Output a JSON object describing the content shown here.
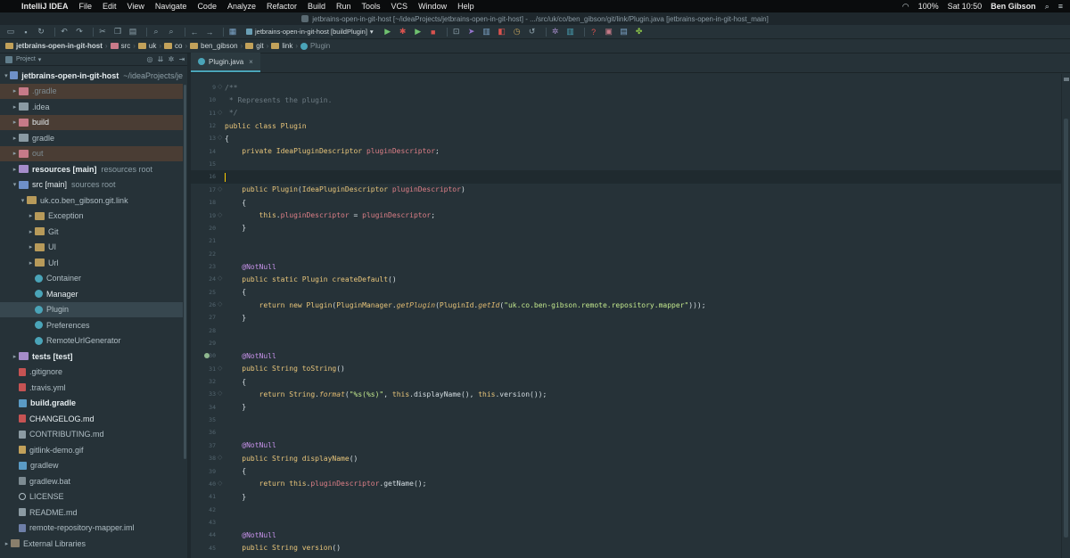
{
  "menubar": {
    "app_name": "IntelliJ IDEA",
    "items": [
      "File",
      "Edit",
      "View",
      "Navigate",
      "Code",
      "Analyze",
      "Refactor",
      "Build",
      "Run",
      "Tools",
      "VCS",
      "Window",
      "Help"
    ],
    "battery": "100%",
    "clock": "Sat 10:50",
    "user": "Ben Gibson"
  },
  "window": {
    "title": "jetbrains-open-in-git-host [~/ideaProjects/jetbrains-open-in-git-host] - .../src/uk/co/ben_gibson/git/link/Plugin.java [jetbrains-open-in-git-host_main]"
  },
  "toolbar": {
    "run_config": "jetbrains-open-in-git-host [buildPlugin]"
  },
  "breadcrumbs": [
    "jetbrains-open-in-git-host",
    "src",
    "uk",
    "co",
    "ben_gibson",
    "git",
    "link",
    "Plugin"
  ],
  "project_panel": {
    "title": "Project"
  },
  "tree": [
    {
      "label": "jetbrains-open-in-git-host",
      "hint": "~/ideaProjects/je",
      "depth": 0,
      "arrow": "v",
      "icon": "folder-blue",
      "style": "bold"
    },
    {
      "label": ".gradle",
      "hint": "",
      "depth": 1,
      "arrow": ">",
      "icon": "folder-pink",
      "style": "dim",
      "hl": "brown"
    },
    {
      "label": ".idea",
      "hint": "",
      "depth": 1,
      "arrow": ">",
      "icon": "folder",
      "style": ""
    },
    {
      "label": "build",
      "hint": "",
      "depth": 1,
      "arrow": ">",
      "icon": "folder-pink",
      "style": "white",
      "hl": "brown"
    },
    {
      "label": "gradle",
      "hint": "",
      "depth": 1,
      "arrow": ">",
      "icon": "folder",
      "style": ""
    },
    {
      "label": "out",
      "hint": "",
      "depth": 1,
      "arrow": ">",
      "icon": "folder-pink",
      "style": "dim",
      "hl": "brown"
    },
    {
      "label": "resources [main]",
      "hint": "resources root",
      "depth": 1,
      "arrow": ">",
      "icon": "folder-purple",
      "style": "bold"
    },
    {
      "label": "src [main]",
      "hint": "sources root",
      "depth": 1,
      "arrow": "v",
      "icon": "folder-blue",
      "style": "white"
    },
    {
      "label": "uk.co.ben_gibson.git.link",
      "hint": "",
      "depth": 2,
      "arrow": "v",
      "icon": "pkg",
      "style": ""
    },
    {
      "label": "Exception",
      "hint": "",
      "depth": 3,
      "arrow": ">",
      "icon": "pkg",
      "style": ""
    },
    {
      "label": "Git",
      "hint": "",
      "depth": 3,
      "arrow": ">",
      "icon": "pkg",
      "style": ""
    },
    {
      "label": "UI",
      "hint": "",
      "depth": 3,
      "arrow": ">",
      "icon": "pkg",
      "style": ""
    },
    {
      "label": "Url",
      "hint": "",
      "depth": 3,
      "arrow": ">",
      "icon": "pkg",
      "style": ""
    },
    {
      "label": "Container",
      "hint": "",
      "depth": 3,
      "arrow": "",
      "icon": "cls",
      "style": ""
    },
    {
      "label": "Manager",
      "hint": "",
      "depth": 3,
      "arrow": "",
      "icon": "cls",
      "style": "white"
    },
    {
      "label": "Plugin",
      "hint": "",
      "depth": 3,
      "arrow": "",
      "icon": "cls",
      "style": "",
      "selected": true
    },
    {
      "label": "Preferences",
      "hint": "",
      "depth": 3,
      "arrow": "",
      "icon": "cls",
      "style": ""
    },
    {
      "label": "RemoteUrlGenerator",
      "hint": "",
      "depth": 3,
      "arrow": "",
      "icon": "cls",
      "style": ""
    },
    {
      "label": "tests [test]",
      "hint": "",
      "depth": 1,
      "arrow": ">",
      "icon": "folder-purple",
      "style": "bold"
    },
    {
      "label": ".gitignore",
      "hint": "",
      "depth": 1,
      "arrow": "",
      "icon": "file-red",
      "style": ""
    },
    {
      "label": ".travis.yml",
      "hint": "",
      "depth": 1,
      "arrow": "",
      "icon": "file-red",
      "style": ""
    },
    {
      "label": "build.gradle",
      "hint": "",
      "depth": 1,
      "arrow": "",
      "icon": "gradle",
      "style": "bold"
    },
    {
      "label": "CHANGELOG.md",
      "hint": "",
      "depth": 1,
      "arrow": "",
      "icon": "file-red",
      "style": "white"
    },
    {
      "label": "CONTRIBUTING.md",
      "hint": "",
      "depth": 1,
      "arrow": "",
      "icon": "file-md",
      "style": ""
    },
    {
      "label": "gitlink-demo.gif",
      "hint": "",
      "depth": 1,
      "arrow": "",
      "icon": "gif",
      "style": ""
    },
    {
      "label": "gradlew",
      "hint": "",
      "depth": 1,
      "arrow": "",
      "icon": "gradle",
      "style": ""
    },
    {
      "label": "gradlew.bat",
      "hint": "",
      "depth": 1,
      "arrow": "",
      "icon": "file-gray",
      "style": ""
    },
    {
      "label": "LICENSE",
      "hint": "",
      "depth": 1,
      "arrow": "",
      "icon": "license",
      "style": ""
    },
    {
      "label": "README.md",
      "hint": "",
      "depth": 1,
      "arrow": "",
      "icon": "file-md",
      "style": ""
    },
    {
      "label": "remote-repository-mapper.iml",
      "hint": "",
      "depth": 1,
      "arrow": "",
      "icon": "iml",
      "style": ""
    },
    {
      "label": "External Libraries",
      "hint": "",
      "depth": 0,
      "arrow": ">",
      "icon": "lib",
      "style": ""
    }
  ],
  "editor": {
    "tab_label": "Plugin.java",
    "first_line_number": 9,
    "current_line": 16,
    "lines": [
      [
        {
          "t": "/**",
          "c": "cmt"
        }
      ],
      [
        {
          "t": " * Represents the plugin.",
          "c": "cmt"
        }
      ],
      [
        {
          "t": " */",
          "c": "cmt"
        }
      ],
      [
        {
          "t": "public class ",
          "c": "kw"
        },
        {
          "t": "Plugin",
          "c": "type"
        }
      ],
      [
        {
          "t": "{",
          "c": ""
        }
      ],
      [
        {
          "t": "    private ",
          "c": "kw"
        },
        {
          "t": "IdeaPluginDescriptor ",
          "c": "type"
        },
        {
          "t": "pluginDescriptor",
          "c": "fld"
        },
        {
          "t": ";",
          "c": ""
        }
      ],
      [],
      [],
      [
        {
          "t": "    public ",
          "c": "kw"
        },
        {
          "t": "Plugin",
          "c": "fn"
        },
        {
          "t": "(",
          "c": ""
        },
        {
          "t": "IdeaPluginDescriptor ",
          "c": "type"
        },
        {
          "t": "pluginDescriptor",
          "c": "fld"
        },
        {
          "t": ")",
          "c": ""
        }
      ],
      [
        {
          "t": "    {",
          "c": ""
        }
      ],
      [
        {
          "t": "        this",
          "c": "kw"
        },
        {
          "t": ".",
          "c": ""
        },
        {
          "t": "pluginDescriptor",
          "c": "fld"
        },
        {
          "t": " = ",
          "c": ""
        },
        {
          "t": "pluginDescriptor",
          "c": "fld"
        },
        {
          "t": ";",
          "c": ""
        }
      ],
      [
        {
          "t": "    }",
          "c": ""
        }
      ],
      [],
      [],
      [
        {
          "t": "    @NotNull",
          "c": "anno"
        }
      ],
      [
        {
          "t": "    public static ",
          "c": "kw"
        },
        {
          "t": "Plugin ",
          "c": "type"
        },
        {
          "t": "createDefault",
          "c": "fn"
        },
        {
          "t": "()",
          "c": ""
        }
      ],
      [
        {
          "t": "    {",
          "c": ""
        }
      ],
      [
        {
          "t": "        return new ",
          "c": "kw"
        },
        {
          "t": "Plugin",
          "c": "fn"
        },
        {
          "t": "(",
          "c": ""
        },
        {
          "t": "PluginManager",
          "c": "type"
        },
        {
          "t": ".",
          "c": ""
        },
        {
          "t": "getPlugin",
          "c": "ital"
        },
        {
          "t": "(",
          "c": ""
        },
        {
          "t": "PluginId",
          "c": "type"
        },
        {
          "t": ".",
          "c": ""
        },
        {
          "t": "getId",
          "c": "ital"
        },
        {
          "t": "(",
          "c": ""
        },
        {
          "t": "\"uk.co.ben-gibson.remote.repository.mapper\"",
          "c": "str"
        },
        {
          "t": ")));",
          "c": ""
        }
      ],
      [
        {
          "t": "    }",
          "c": ""
        }
      ],
      [],
      [],
      [
        {
          "t": "    @NotNull",
          "c": "anno"
        }
      ],
      [
        {
          "t": "    public ",
          "c": "kw"
        },
        {
          "t": "String ",
          "c": "type"
        },
        {
          "t": "toString",
          "c": "fn"
        },
        {
          "t": "()",
          "c": ""
        }
      ],
      [
        {
          "t": "    {",
          "c": ""
        }
      ],
      [
        {
          "t": "        return ",
          "c": "kw"
        },
        {
          "t": "String",
          "c": "type"
        },
        {
          "t": ".",
          "c": ""
        },
        {
          "t": "format",
          "c": "ital"
        },
        {
          "t": "(",
          "c": ""
        },
        {
          "t": "\"%s(%s)\"",
          "c": "str"
        },
        {
          "t": ", ",
          "c": ""
        },
        {
          "t": "this",
          "c": "kw"
        },
        {
          "t": ".displayName(), ",
          "c": ""
        },
        {
          "t": "this",
          "c": "kw"
        },
        {
          "t": ".version());",
          "c": ""
        }
      ],
      [
        {
          "t": "    }",
          "c": ""
        }
      ],
      [],
      [],
      [
        {
          "t": "    @NotNull",
          "c": "anno"
        }
      ],
      [
        {
          "t": "    public ",
          "c": "kw"
        },
        {
          "t": "String ",
          "c": "type"
        },
        {
          "t": "displayName",
          "c": "fn"
        },
        {
          "t": "()",
          "c": ""
        }
      ],
      [
        {
          "t": "    {",
          "c": ""
        }
      ],
      [
        {
          "t": "        return this",
          "c": "kw"
        },
        {
          "t": ".",
          "c": ""
        },
        {
          "t": "pluginDescriptor",
          "c": "fld"
        },
        {
          "t": ".getName();",
          "c": ""
        }
      ],
      [
        {
          "t": "    }",
          "c": ""
        }
      ],
      [],
      [],
      [
        {
          "t": "    @NotNull",
          "c": "anno"
        }
      ],
      [
        {
          "t": "    public ",
          "c": "kw"
        },
        {
          "t": "String ",
          "c": "type"
        },
        {
          "t": "version",
          "c": "fn"
        },
        {
          "t": "()",
          "c": ""
        }
      ]
    ]
  }
}
